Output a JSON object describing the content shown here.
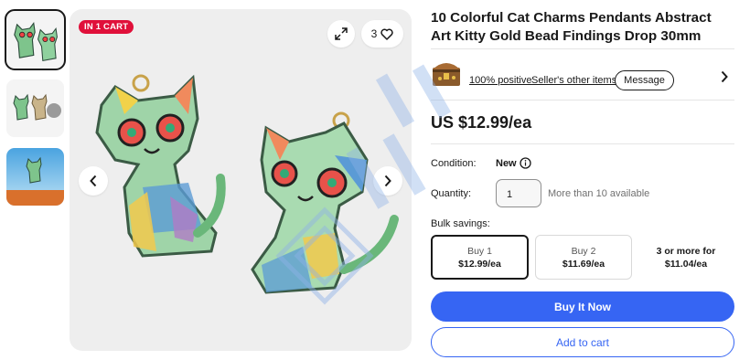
{
  "thumbnails": [
    {
      "alt_icon": "cat-pendant-pair-thumbnail",
      "selected": true
    },
    {
      "alt_icon": "cat-pendant-coin-thumbnail",
      "selected": false
    },
    {
      "alt_icon": "cat-pendant-scene-thumbnail",
      "selected": false
    }
  ],
  "gallery": {
    "badge": "IN 1 CART",
    "watch_count": "3"
  },
  "product": {
    "title": "10 Colorful Cat Charms Pendants Abstract Art Kitty Gold Bead Findings Drop 30mm",
    "price": "US $12.99/ea"
  },
  "seller": {
    "positive": "100% positive",
    "separator": "·",
    "other_items": "Seller's other items",
    "message": "Message"
  },
  "details": {
    "condition_label": "Condition:",
    "condition_value": "New",
    "quantity_label": "Quantity:",
    "quantity_value": "1",
    "availability": "More than 10 available",
    "bulk_label": "Bulk savings:"
  },
  "bulk_tiers": [
    {
      "qty": "Buy 1",
      "price": "$12.99/ea"
    },
    {
      "qty": "Buy 2",
      "price": "$11.69/ea"
    },
    {
      "qty": "3 or more for",
      "price": "$11.04/ea"
    }
  ],
  "actions": {
    "buy_now": "Buy It Now",
    "add_to_cart": "Add to cart"
  },
  "colors": {
    "accent": "#3665f3",
    "badge": "#e0103a",
    "text": "#191919"
  }
}
